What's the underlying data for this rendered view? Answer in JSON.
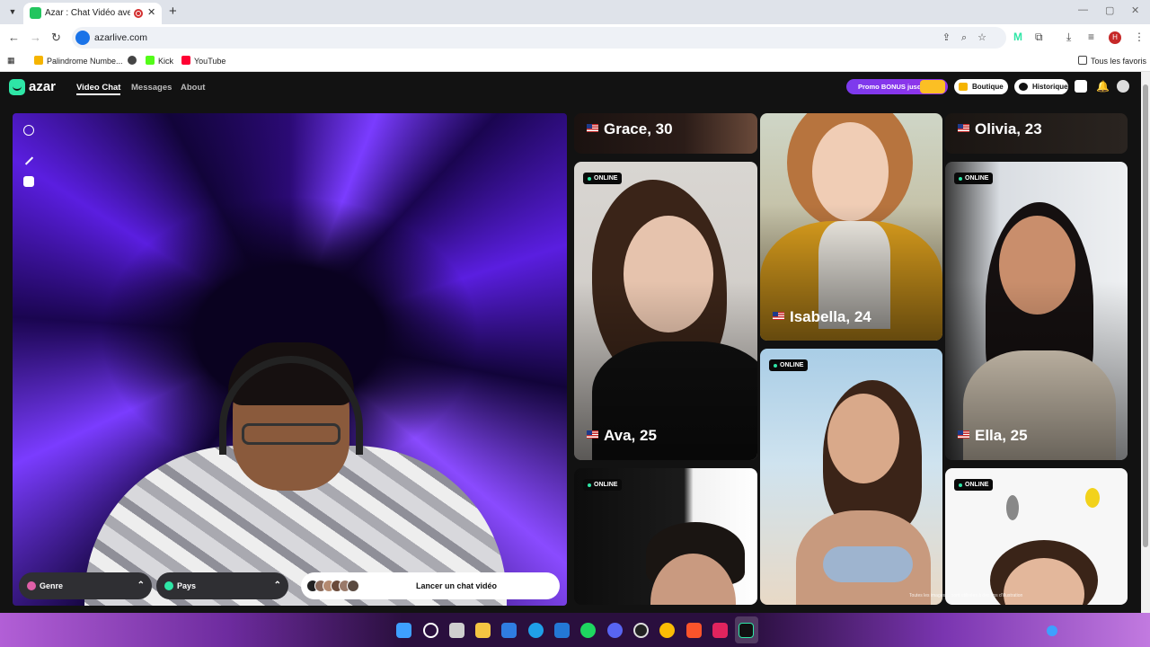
{
  "browser": {
    "tab_title": "Azar : Chat Vidéo avec de n",
    "url": "azarlive.com",
    "profile_initial": "H",
    "bookmarks": [
      "Palindrome Numbe...",
      "Kick",
      "YouTube"
    ],
    "all_bookmarks": "Tous les favoris"
  },
  "header": {
    "logo": "azar",
    "nav": [
      "Video Chat",
      "Messages",
      "About"
    ],
    "promo": "Promo BONUS jusq",
    "boutique": "Boutique",
    "historique": "Historique"
  },
  "video_panel": {
    "genre_label": "Genre",
    "pays_label": "Pays",
    "launch_label": "Lancer un chat vidéo"
  },
  "cards": {
    "grace": "Grace, 30",
    "isabella": "Isabella, 24",
    "olivia": "Olivia, 23",
    "ava": "Ava, 25",
    "ella": "Ella, 25",
    "online_badge": "ONLINE"
  },
  "disclaimer": "Toutes les images ... sont utilisées à des fins d'illustration",
  "colors": {
    "accent": "#2ee6a6",
    "promo": "#8b3cf0",
    "background": "#121212"
  }
}
